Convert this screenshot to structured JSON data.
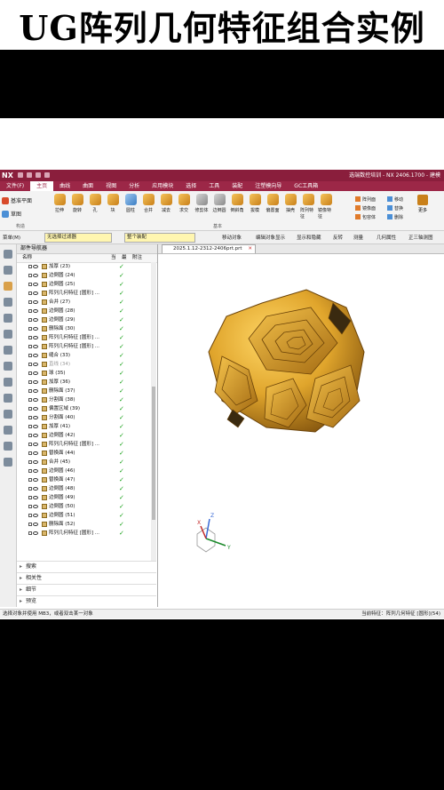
{
  "banner": {
    "title": "UG阵列几何特征组合实例"
  },
  "window": {
    "logo": "NX",
    "title": "选端数控培训 - NX 2406.1700 - 建模"
  },
  "menu": [
    "文件(F)",
    "主页",
    "曲线",
    "曲面",
    "视图",
    "分析",
    "应用模块",
    "选择",
    "工具",
    "装配",
    "注塑模向导",
    "GC工具箱"
  ],
  "menu_active": "主页",
  "ribbon": {
    "left": [
      "基准平面",
      "草图"
    ],
    "tools": [
      "拉伸",
      "旋转",
      "孔",
      "块",
      "圆柱",
      "合并",
      "减去",
      "求交",
      "修剪体",
      "边倒圆",
      "倒斜角",
      "拔模",
      "偏置面",
      "抽壳",
      "阵列特征",
      "镜像特征"
    ],
    "right_col1": [
      "阵列面",
      "镜像面",
      "包容体"
    ],
    "right_col2": [
      "移动",
      "替换",
      "删除"
    ],
    "right_extra": "更多",
    "groups": [
      "构造",
      "基本"
    ]
  },
  "selection_bar": {
    "menu": "菜单(M)",
    "filter": "无选择过滤器",
    "assembly": "整个装配",
    "commands": [
      "移动对象",
      "编辑对象显示",
      "显示和隐藏",
      "反转",
      "测量",
      "几何属性",
      "正三轴测图"
    ]
  },
  "navigator": {
    "title": "部件导航器",
    "columns": [
      "名称",
      "当",
      "最",
      "附注"
    ],
    "rows": [
      {
        "label": "加厚 (23)",
        "ok": true
      },
      {
        "label": "边倒圆 (24)",
        "ok": true
      },
      {
        "label": "边倒圆 (25)",
        "ok": true
      },
      {
        "label": "阵列几何特征 [圆形] ...",
        "ok": true
      },
      {
        "label": "合并 (27)",
        "ok": true
      },
      {
        "label": "边倒圆 (28)",
        "ok": true
      },
      {
        "label": "边倒圆 (29)",
        "ok": true
      },
      {
        "label": "删除面 (30)",
        "ok": true
      },
      {
        "label": "阵列几何特征 [圆形] ...",
        "ok": true
      },
      {
        "label": "阵列几何特征 [圆形] ...",
        "ok": true
      },
      {
        "label": "缝合 (33)",
        "ok": true
      },
      {
        "label": "直线 (34)",
        "ok": true,
        "grey": true
      },
      {
        "label": "球 (35)",
        "ok": true
      },
      {
        "label": "加厚 (36)",
        "ok": true
      },
      {
        "label": "删除面 (37)",
        "ok": true
      },
      {
        "label": "分割面 (38)",
        "ok": true
      },
      {
        "label": "偏置区域 (39)",
        "ok": true
      },
      {
        "label": "分割面 (40)",
        "ok": true
      },
      {
        "label": "加厚 (41)",
        "ok": true
      },
      {
        "label": "边倒圆 (42)",
        "ok": true
      },
      {
        "label": "阵列几何特征 [圆形] ...",
        "ok": true
      },
      {
        "label": "替换面 (44)",
        "ok": true
      },
      {
        "label": "合并 (45)",
        "ok": true
      },
      {
        "label": "边倒圆 (46)",
        "ok": true
      },
      {
        "label": "替换面 (47)",
        "ok": true
      },
      {
        "label": "边倒圆 (48)",
        "ok": true
      },
      {
        "label": "边倒圆 (49)",
        "ok": true
      },
      {
        "label": "边倒圆 (50)",
        "ok": true
      },
      {
        "label": "边倒圆 (51)",
        "ok": true
      },
      {
        "label": "删除面 (52)",
        "ok": true
      },
      {
        "label": "阵列几何特征 [圆形] ...",
        "ok": true
      }
    ],
    "panels": [
      "搜索",
      "相关性",
      "细节",
      "预览"
    ]
  },
  "viewport": {
    "tab": "2025.1.12-2312-2406prt.prt"
  },
  "status": {
    "left": "选择对象并使用 MB3，或者双击某一对象",
    "right": "当前特征：阵列几何特征 [圆形](54)"
  },
  "colors": {
    "accent": "#9c2747",
    "model": "#e0a52c",
    "ok": "#1aa11a"
  }
}
